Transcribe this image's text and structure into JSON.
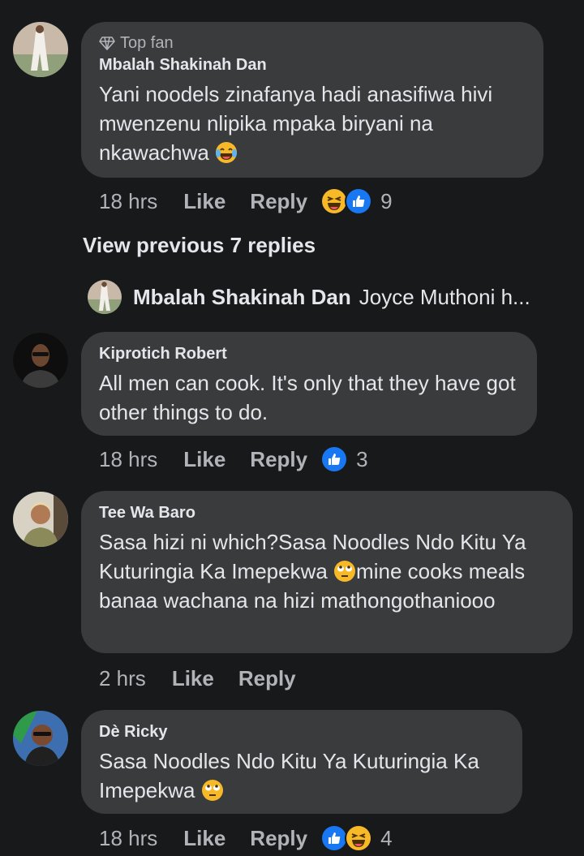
{
  "comments": [
    {
      "badge": "Top fan",
      "author": "Mbalah Shakinah Dan",
      "text": "Yani noodels zinafanya hadi anasifiwa hivi mwenzenu nlipika mpaka biryani na nkawachwa",
      "trailing_emoji": "laughing-tears",
      "time": "18 hrs",
      "like": "Like",
      "reply": "Reply",
      "reactions": [
        "haha",
        "like"
      ],
      "reaction_count": "9"
    },
    {
      "author": "Kiprotich Robert",
      "text": "All men can cook. It's only that  they have got  other things to do.",
      "time": "18 hrs",
      "like": "Like",
      "reply": "Reply",
      "reactions": [
        "like"
      ],
      "reaction_count": "3"
    },
    {
      "author": "Tee Wa Baro",
      "text_part1": "Sasa hizi ni which?Sasa Noodles Ndo Kitu Ya Kuturingia Ka Imepekwa ",
      "text_part2": "mine cooks meals banaa wachana na hizi mathongothaniooo",
      "time": "2 hrs",
      "like": "Like",
      "reply": "Reply"
    },
    {
      "author": "Dè Ricky",
      "text": "Sasa Noodles Ndo Kitu Ya Kuturingia Ka Imepekwa",
      "time": "18 hrs",
      "like": "Like",
      "reply": "Reply",
      "reactions": [
        "like",
        "haha"
      ],
      "reaction_count": "4"
    }
  ],
  "view_previous": "View previous 7 replies",
  "reply_preview": {
    "author": "Mbalah Shakinah Dan",
    "text": "Joyce Muthoni h..."
  },
  "colors": {
    "background": "#18191a",
    "bubble": "#3a3b3c",
    "text": "#e4e6eb",
    "muted": "#b0b3b8",
    "like_blue": "#1877f2",
    "haha_yellow": "#f7b928"
  }
}
